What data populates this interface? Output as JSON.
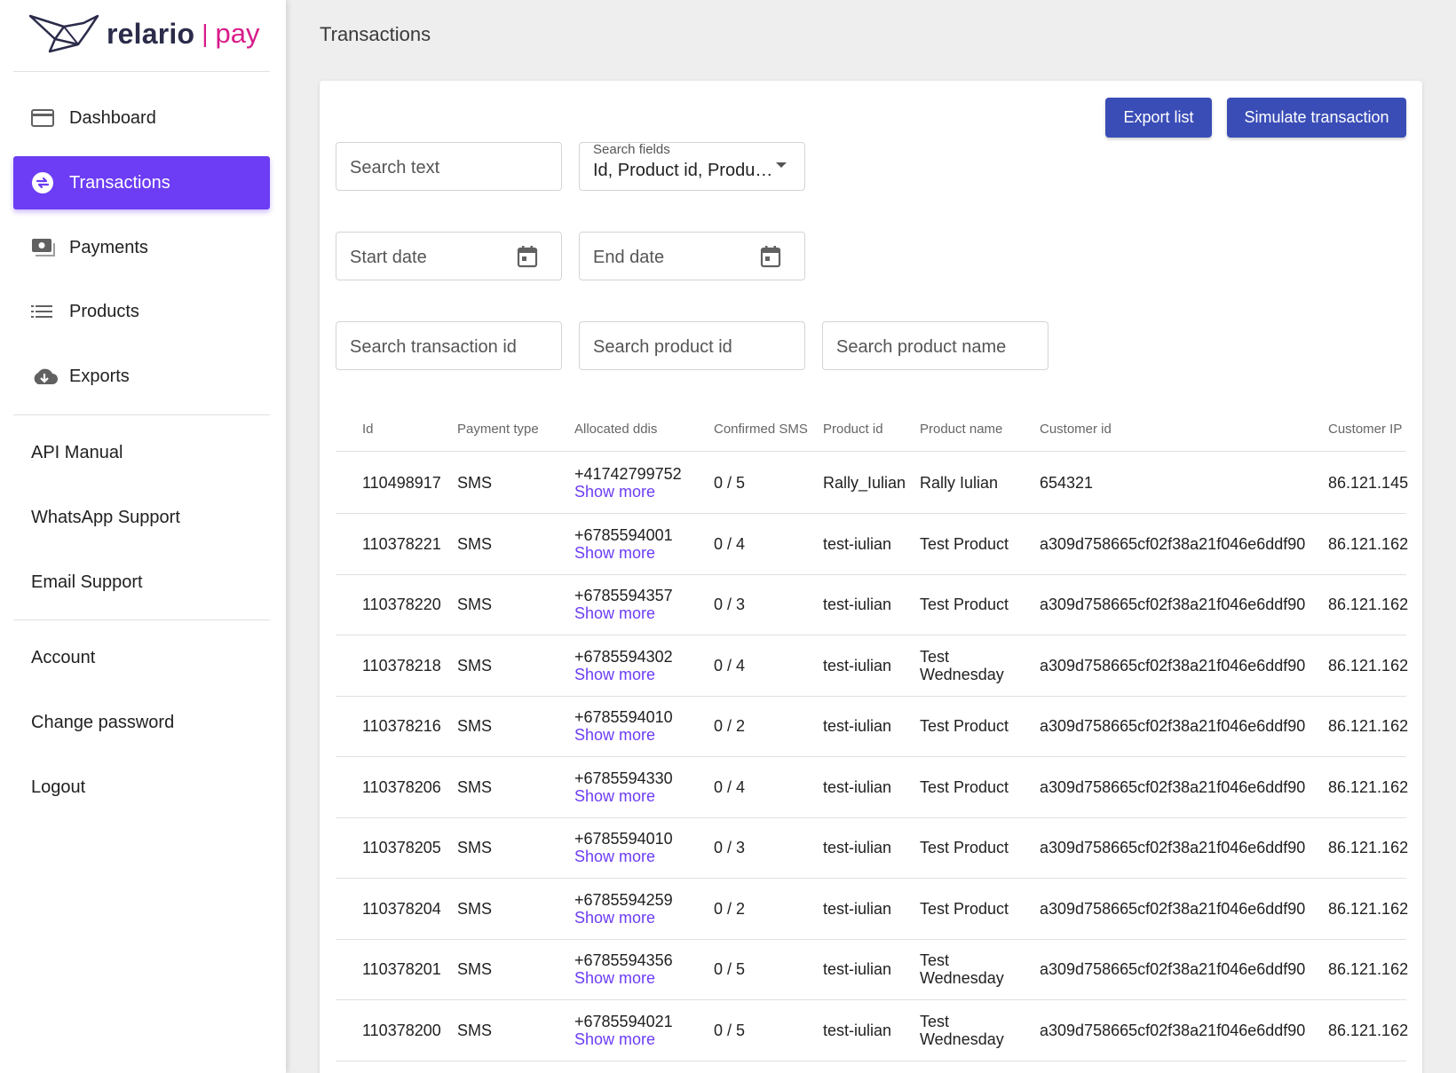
{
  "brand": {
    "name": "relario",
    "sep": "|",
    "suffix": "pay"
  },
  "sidebar": {
    "nav": [
      {
        "label": "Dashboard",
        "icon": "credit-card-icon"
      },
      {
        "label": "Transactions",
        "icon": "swap-icon",
        "active": true
      },
      {
        "label": "Payments",
        "icon": "money-icon"
      },
      {
        "label": "Products",
        "icon": "list-icon"
      },
      {
        "label": "Exports",
        "icon": "cloud-download-icon"
      }
    ],
    "links": [
      "API Manual",
      "WhatsApp Support",
      "Email Support"
    ],
    "account_links": [
      "Account",
      "Change password",
      "Logout"
    ]
  },
  "page": {
    "title": "Transactions"
  },
  "actions": {
    "export": "Export list",
    "simulate": "Simulate transaction"
  },
  "filters": {
    "search_text": "Search text",
    "search_fields_label": "Search fields",
    "search_fields_value": "Id, Product id, Product name",
    "start_date": "Start date",
    "end_date": "End date",
    "transaction_id": "Search transaction id",
    "product_id": "Search product id",
    "product_name": "Search product name"
  },
  "table": {
    "columns": [
      "Id",
      "Payment type",
      "Allocated ddis",
      "Confirmed SMS",
      "Product id",
      "Product name",
      "Customer id",
      "Customer IP"
    ],
    "show_more": "Show more",
    "rows": [
      {
        "id": "110498917",
        "type": "SMS",
        "ddi": "+41742799752",
        "sms": "0 / 5",
        "pid": "Rally_Iulian",
        "pname": "Rally Iulian",
        "cid": "654321",
        "ip": "86.121.145"
      },
      {
        "id": "110378221",
        "type": "SMS",
        "ddi": "+6785594001",
        "sms": "0 / 4",
        "pid": "test-iulian",
        "pname": "Test Product",
        "cid": "a309d758665cf02f38a21f046e6ddf90",
        "ip": "86.121.162"
      },
      {
        "id": "110378220",
        "type": "SMS",
        "ddi": "+6785594357",
        "sms": "0 / 3",
        "pid": "test-iulian",
        "pname": "Test Product",
        "cid": "a309d758665cf02f38a21f046e6ddf90",
        "ip": "86.121.162"
      },
      {
        "id": "110378218",
        "type": "SMS",
        "ddi": "+6785594302",
        "sms": "0 / 4",
        "pid": "test-iulian",
        "pname": "Test\nWednesday",
        "cid": "a309d758665cf02f38a21f046e6ddf90",
        "ip": "86.121.162"
      },
      {
        "id": "110378216",
        "type": "SMS",
        "ddi": "+6785594010",
        "sms": "0 / 2",
        "pid": "test-iulian",
        "pname": "Test Product",
        "cid": "a309d758665cf02f38a21f046e6ddf90",
        "ip": "86.121.162"
      },
      {
        "id": "110378206",
        "type": "SMS",
        "ddi": "+6785594330",
        "sms": "0 / 4",
        "pid": "test-iulian",
        "pname": "Test Product",
        "cid": "a309d758665cf02f38a21f046e6ddf90",
        "ip": "86.121.162"
      },
      {
        "id": "110378205",
        "type": "SMS",
        "ddi": "+6785594010",
        "sms": "0 / 3",
        "pid": "test-iulian",
        "pname": "Test Product",
        "cid": "a309d758665cf02f38a21f046e6ddf90",
        "ip": "86.121.162"
      },
      {
        "id": "110378204",
        "type": "SMS",
        "ddi": "+6785594259",
        "sms": "0 / 2",
        "pid": "test-iulian",
        "pname": "Test Product",
        "cid": "a309d758665cf02f38a21f046e6ddf90",
        "ip": "86.121.162"
      },
      {
        "id": "110378201",
        "type": "SMS",
        "ddi": "+6785594356",
        "sms": "0 / 5",
        "pid": "test-iulian",
        "pname": "Test\nWednesday",
        "cid": "a309d758665cf02f38a21f046e6ddf90",
        "ip": "86.121.162"
      },
      {
        "id": "110378200",
        "type": "SMS",
        "ddi": "+6785594021",
        "sms": "0 / 5",
        "pid": "test-iulian",
        "pname": "Test\nWednesday",
        "cid": "a309d758665cf02f38a21f046e6ddf90",
        "ip": "86.121.162"
      }
    ]
  },
  "colors": {
    "accent": "#6c3df4",
    "button": "#3a4db7",
    "brand_pink": "#d81b8a",
    "brand_dark": "#2b2b4a"
  }
}
